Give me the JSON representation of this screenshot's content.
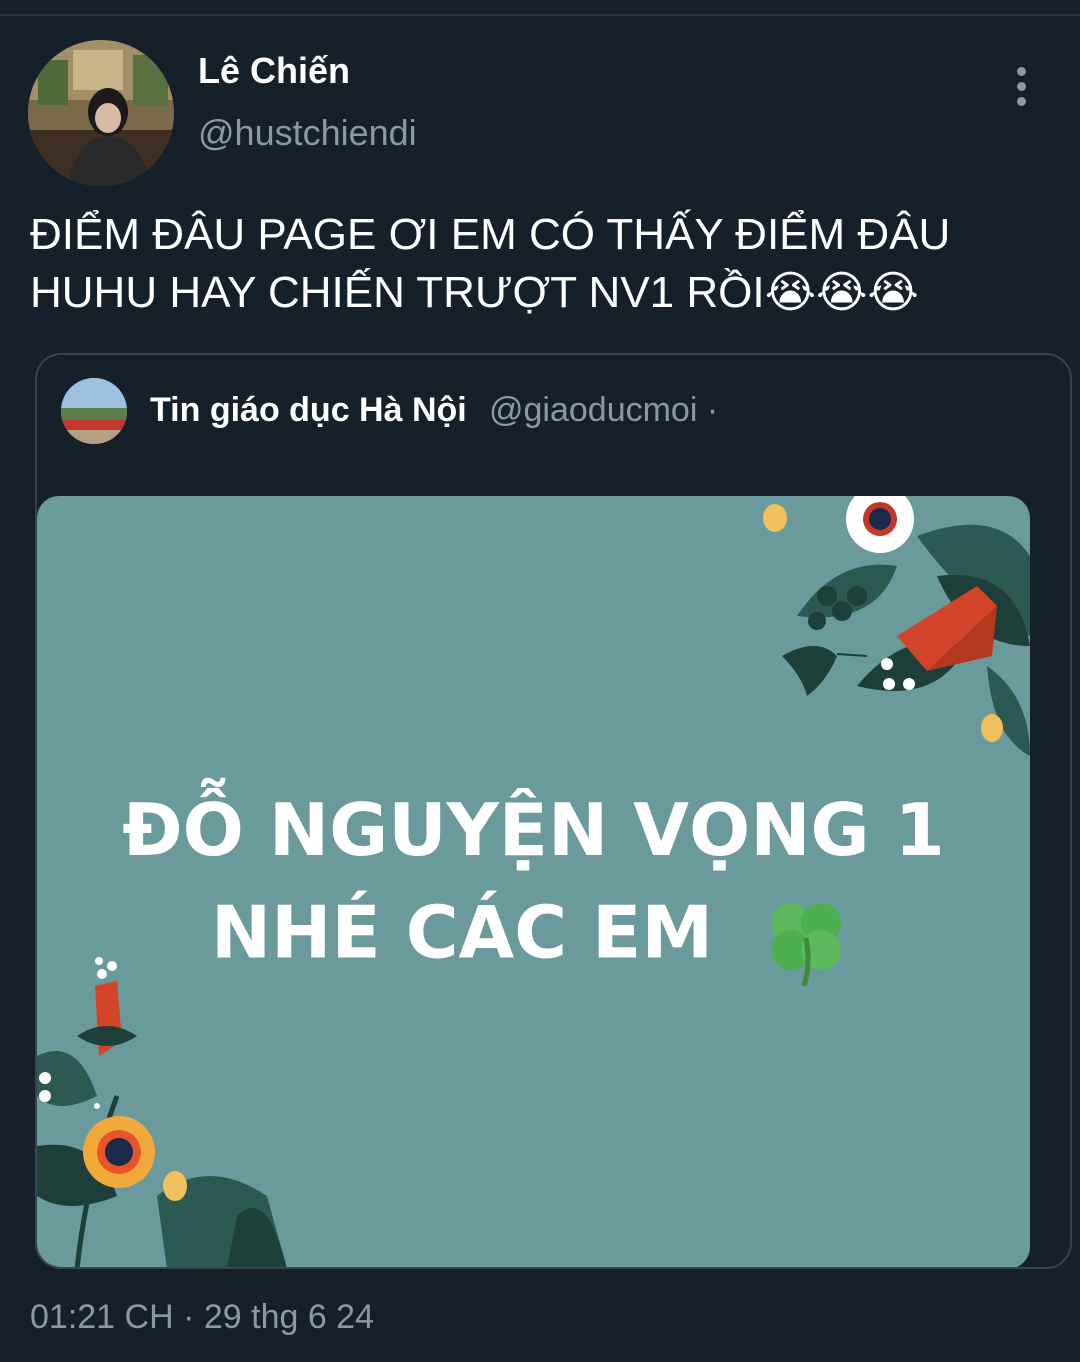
{
  "tweet": {
    "display_name": "Lê Chiến",
    "handle": "@hustchiendi",
    "text": "ĐIỂM ĐÂU PAGE ƠI EM CÓ THẤY ĐIỂM ĐÂU HUHU HAY CHIẾN TRƯỢT NV1 RỒI😭😭😭",
    "timestamp": "01:21 CH · 29 thg 6 24",
    "more_icon": "more-vertical-icon"
  },
  "quote": {
    "display_name": "Tin giáo dục Hà Nội",
    "handle": "@giaoducmoi ·",
    "image_line1": "ĐỖ NGUYỆN VỌNG 1",
    "image_line2": "NHÉ CÁC EM"
  },
  "colors": {
    "background": "#15202b",
    "secondary_text": "#8b98a5",
    "card_border": "#38444d",
    "image_background": "#6a9a9c"
  }
}
